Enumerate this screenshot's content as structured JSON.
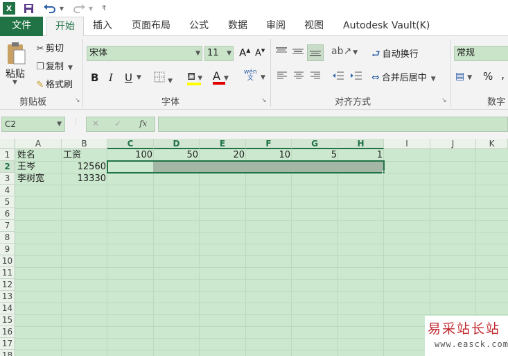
{
  "title_bar": {
    "qat_more": "₹"
  },
  "tabs": [
    {
      "label": "文件"
    },
    {
      "label": "开始"
    },
    {
      "label": "插入"
    },
    {
      "label": "页面布局"
    },
    {
      "label": "公式"
    },
    {
      "label": "数据"
    },
    {
      "label": "审阅"
    },
    {
      "label": "视图"
    },
    {
      "label": "Autodesk Vault(K)"
    }
  ],
  "ribbon": {
    "clipboard": {
      "paste": "粘贴",
      "cut": "剪切",
      "copy": "复制",
      "format_painter": "格式刷",
      "label": "剪贴板"
    },
    "font": {
      "name": "宋体",
      "size": "11",
      "label": "字体",
      "bold": "B",
      "italic": "I",
      "underline": "U",
      "grow": "A",
      "shrink": "A",
      "font_color": "A",
      "phonetic": "wén\n文"
    },
    "alignment": {
      "wrap": "自动换行",
      "merge": "合并后居中",
      "label": "对齐方式"
    },
    "number": {
      "format": "常规",
      "percent": "%",
      "comma": ",",
      "label": "数字"
    }
  },
  "formula_bar": {
    "name_box": "C2",
    "fx": "fx",
    "cancel": "✕",
    "enter": "✓",
    "value": ""
  },
  "columns": [
    "A",
    "B",
    "C",
    "D",
    "E",
    "F",
    "G",
    "H",
    "I",
    "J",
    "K"
  ],
  "rows": [
    "1",
    "2",
    "3",
    "4",
    "5",
    "6",
    "7",
    "8",
    "9",
    "10",
    "11",
    "12",
    "13",
    "14",
    "15",
    "16",
    "17",
    "18"
  ],
  "cells": {
    "A1": "姓名",
    "B1": "工资",
    "C1": "100",
    "D1": "50",
    "E1": "20",
    "F1": "10",
    "G1": "5",
    "H1": "1",
    "A2": "王岑",
    "B2": "12560",
    "A3": "李树宽",
    "B3": "13330"
  },
  "watermark": {
    "line1": "易采站长站",
    "line2": "www.easck.com"
  },
  "colors": {
    "accent": "#217346",
    "grid_bg": "#cce8cf",
    "ribbon_bg": "#f3f3f3"
  }
}
